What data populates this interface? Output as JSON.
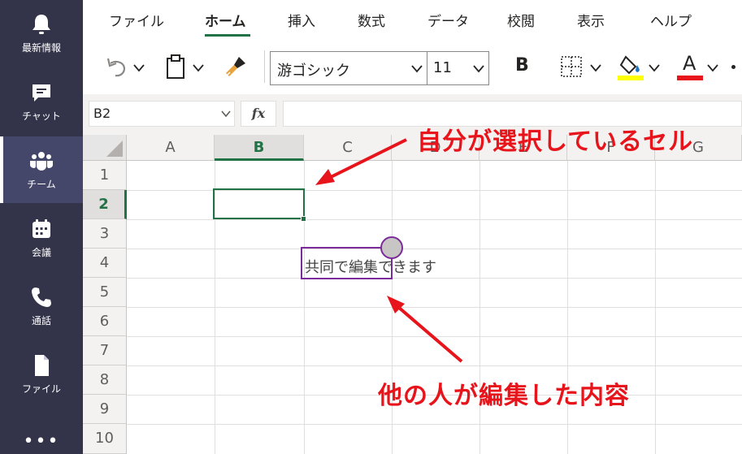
{
  "rail": {
    "items": [
      {
        "label": "最新情報",
        "icon": "bell-icon"
      },
      {
        "label": "チャット",
        "icon": "chat-icon"
      },
      {
        "label": "チーム",
        "icon": "teams-icon",
        "active": true
      },
      {
        "label": "会議",
        "icon": "calendar-icon"
      },
      {
        "label": "通話",
        "icon": "phone-icon"
      },
      {
        "label": "ファイル",
        "icon": "file-icon"
      }
    ],
    "more": "•••"
  },
  "ribbon": {
    "tabs": [
      "ファイル",
      "ホーム",
      "挿入",
      "数式",
      "データ",
      "校閲",
      "表示",
      "ヘルプ"
    ],
    "active_tab": "ホーム"
  },
  "toolbar": {
    "font_name": "游ゴシック",
    "font_size": "11",
    "bold_label": "B",
    "font_color_letter": "A",
    "fill_color": "#ffff00",
    "font_color": "#e8141b"
  },
  "formula_bar": {
    "name_box": "B2",
    "fx_label": "fx"
  },
  "grid": {
    "columns": [
      "A",
      "B",
      "C",
      "D",
      "E",
      "F",
      "G"
    ],
    "rows": [
      "1",
      "2",
      "3",
      "4",
      "5",
      "6",
      "7",
      "8",
      "9",
      "10"
    ],
    "selected_column": "B",
    "selected_row": "2",
    "cell_text": "共同で編集できます"
  },
  "annotations": {
    "top": "自分が選択しているセル",
    "bottom": "他の人が編集した内容"
  },
  "colors": {
    "rail": "#33344a",
    "excel_green": "#217346",
    "collab_purple": "#7b2c9a",
    "annotation_red": "#e8141b"
  }
}
